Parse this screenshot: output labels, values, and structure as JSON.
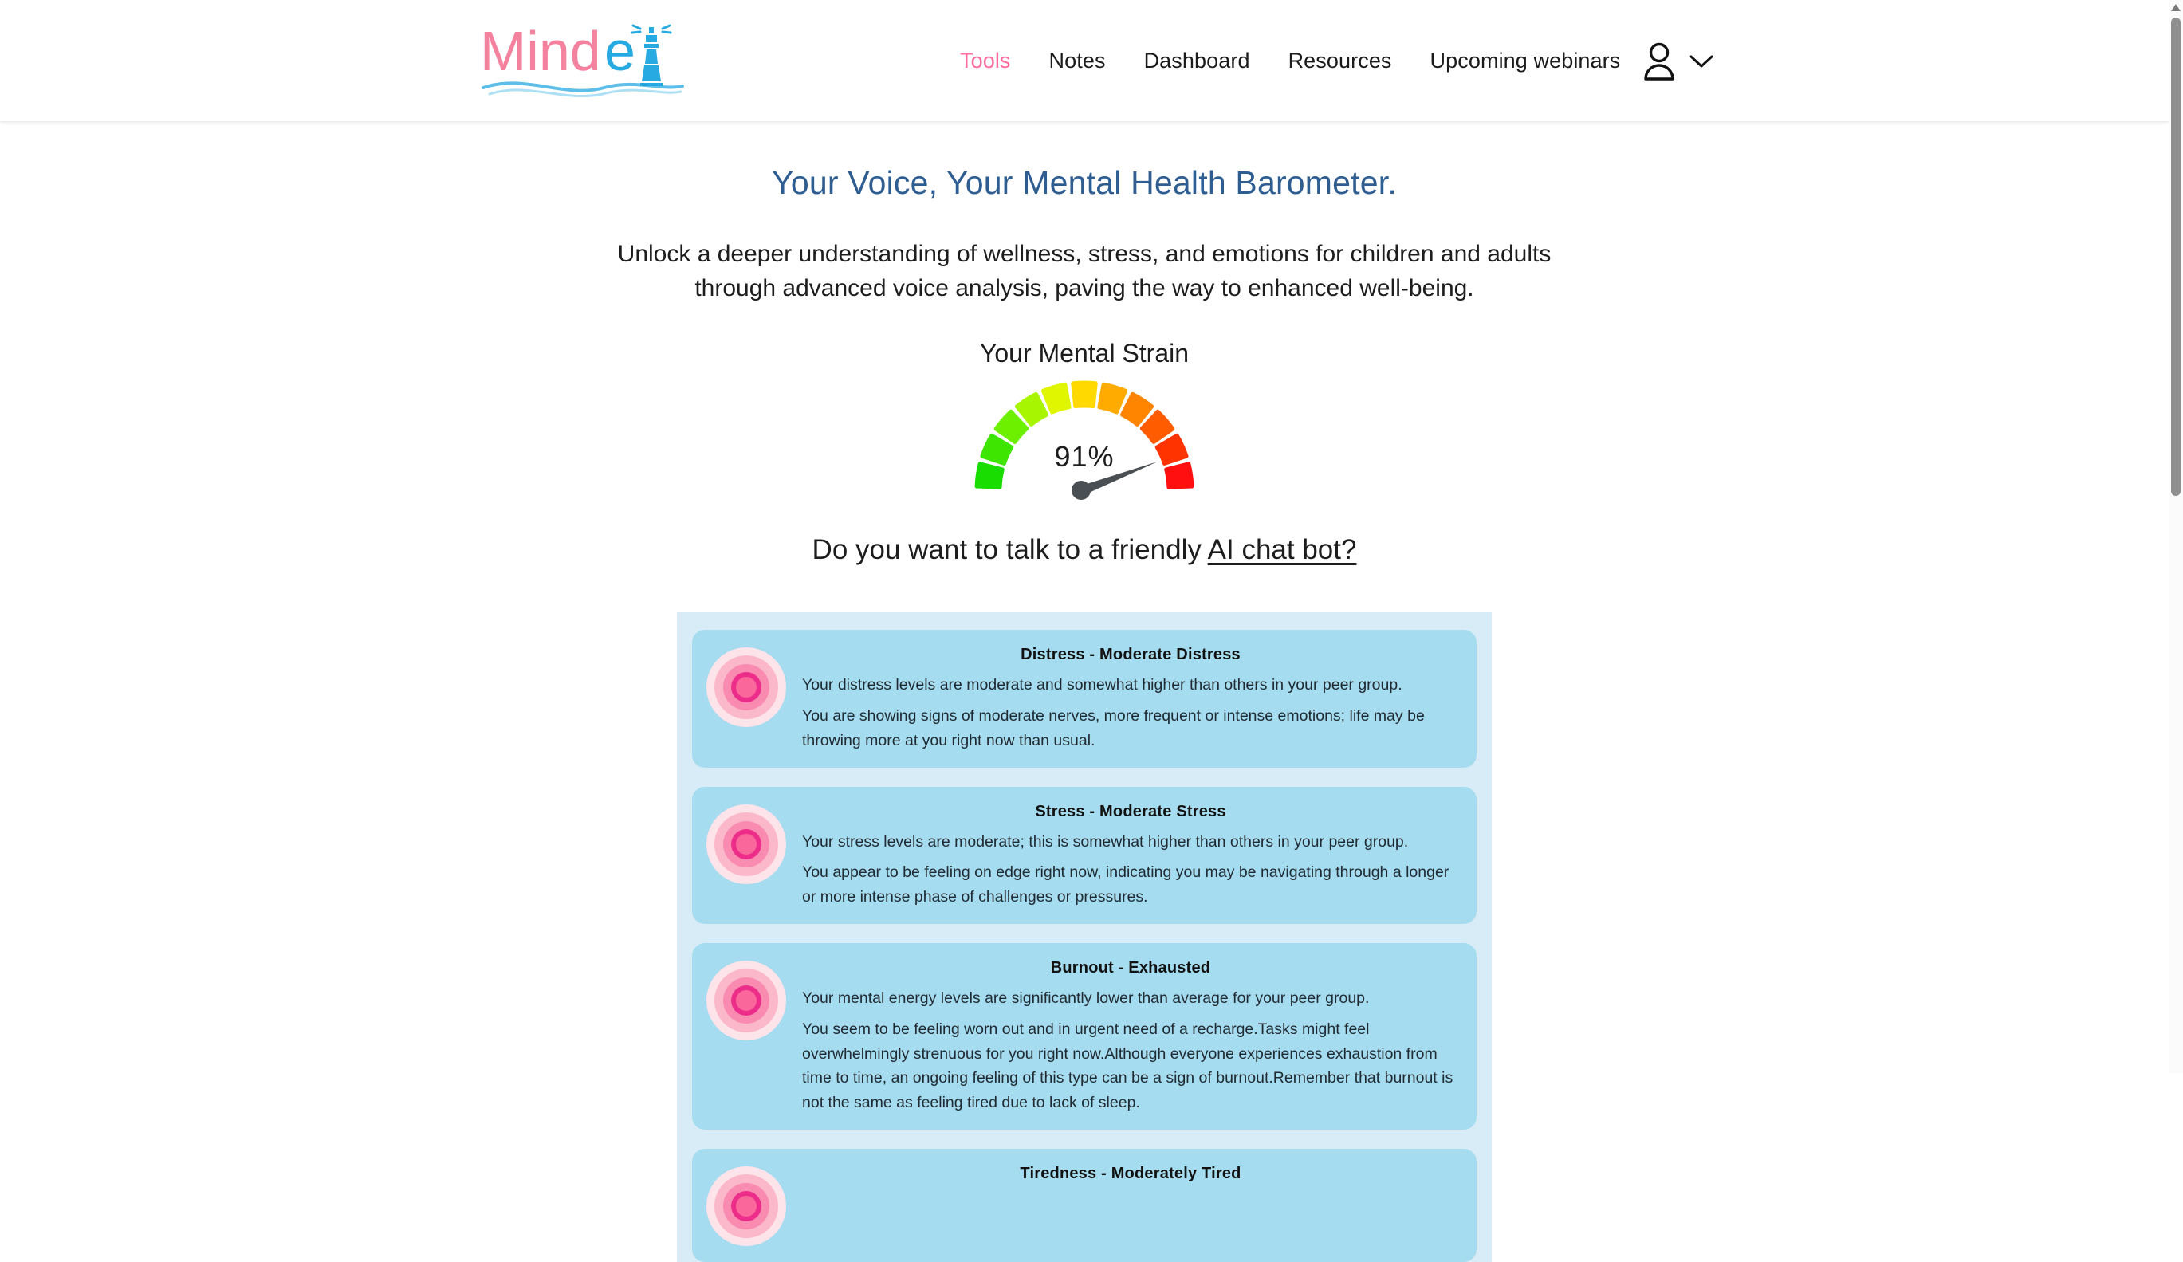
{
  "header": {
    "logo": {
      "text_mind": "Mind",
      "text_e": "e",
      "icon": "lighthouse-icon",
      "pink": "#f4829f",
      "blue": "#27a9e1"
    },
    "nav": [
      {
        "label": "Tools",
        "active": true
      },
      {
        "label": "Notes",
        "active": false
      },
      {
        "label": "Dashboard",
        "active": false
      },
      {
        "label": "Resources",
        "active": false
      },
      {
        "label": "Upcoming webinars",
        "active": false
      }
    ],
    "active_color": "#ff6b9d",
    "user_menu": {
      "icon": "user-icon",
      "chevron": "chevron-down-icon"
    }
  },
  "main": {
    "title": "Your Voice, Your Mental Health Barometer.",
    "title_color": "#2e5d91",
    "subtitle": "Unlock a deeper understanding of wellness, stress, and emotions for children and adults through advanced voice analysis, paving the way to enhanced well-being.",
    "strain_label": "Your Mental Strain",
    "chat_prompt_prefix": "Do you want to talk to a friendly ",
    "chat_link_label": "AI chat bot?"
  },
  "chart_data": {
    "type": "gauge",
    "title": "Your Mental Strain",
    "value": 91,
    "value_label": "91%",
    "unit": "%",
    "min": 0,
    "max": 100,
    "segment_count": 11,
    "start_angle": 180,
    "end_angle": 360,
    "needle_color": "#4a4f54",
    "segment_colors": [
      "#19dd00",
      "#3ee500",
      "#6df000",
      "#a8f500",
      "#e0f500",
      "#ffd900",
      "#ffab00",
      "#ff8400",
      "#ff5c00",
      "#ff3300",
      "#ff0f0f"
    ],
    "segment_values": [
      {
        "from": 0,
        "to": 9
      },
      {
        "from": 9,
        "to": 18
      },
      {
        "from": 18,
        "to": 27
      },
      {
        "from": 27,
        "to": 36
      },
      {
        "from": 36,
        "to": 45
      },
      {
        "from": 45,
        "to": 55
      },
      {
        "from": 55,
        "to": 64
      },
      {
        "from": 64,
        "to": 73
      },
      {
        "from": 73,
        "to": 82
      },
      {
        "from": 82,
        "to": 91
      },
      {
        "from": 91,
        "to": 100
      }
    ]
  },
  "results": {
    "panel_bg": "#d7ecf6",
    "card_bg": "#a6dcef",
    "cards": [
      {
        "icon": "concentric-circles-icon",
        "title": "Distress - Moderate Distress",
        "lines": [
          "Your distress levels are moderate and somewhat higher than others in your peer group.",
          "You are showing signs of moderate nerves, more frequent or intense emotions; life may be throwing more at you right now than usual."
        ]
      },
      {
        "icon": "concentric-circles-icon",
        "title": "Stress - Moderate Stress",
        "lines": [
          "Your stress levels are moderate; this is somewhat higher than others in your peer group.",
          "You appear to be feeling on edge right now, indicating you may be navigating through a longer or more intense phase of challenges or pressures."
        ]
      },
      {
        "icon": "concentric-circles-icon",
        "title": "Burnout - Exhausted",
        "lines": [
          "Your mental energy levels are significantly lower than average for your peer group.",
          "You seem to be feeling worn out and in urgent need of a recharge.Tasks might feel overwhelmingly strenuous for you right now.Although everyone experiences exhaustion from time to time, an ongoing feeling of this type can be a sign of burnout.Remember that burnout is not the same as feeling tired due to lack of sleep."
        ]
      },
      {
        "icon": "concentric-circles-icon",
        "title": "Tiredness - Moderately Tired",
        "lines": []
      }
    ]
  },
  "scrollbar": {
    "arrow_up": "triangle-up-icon"
  }
}
